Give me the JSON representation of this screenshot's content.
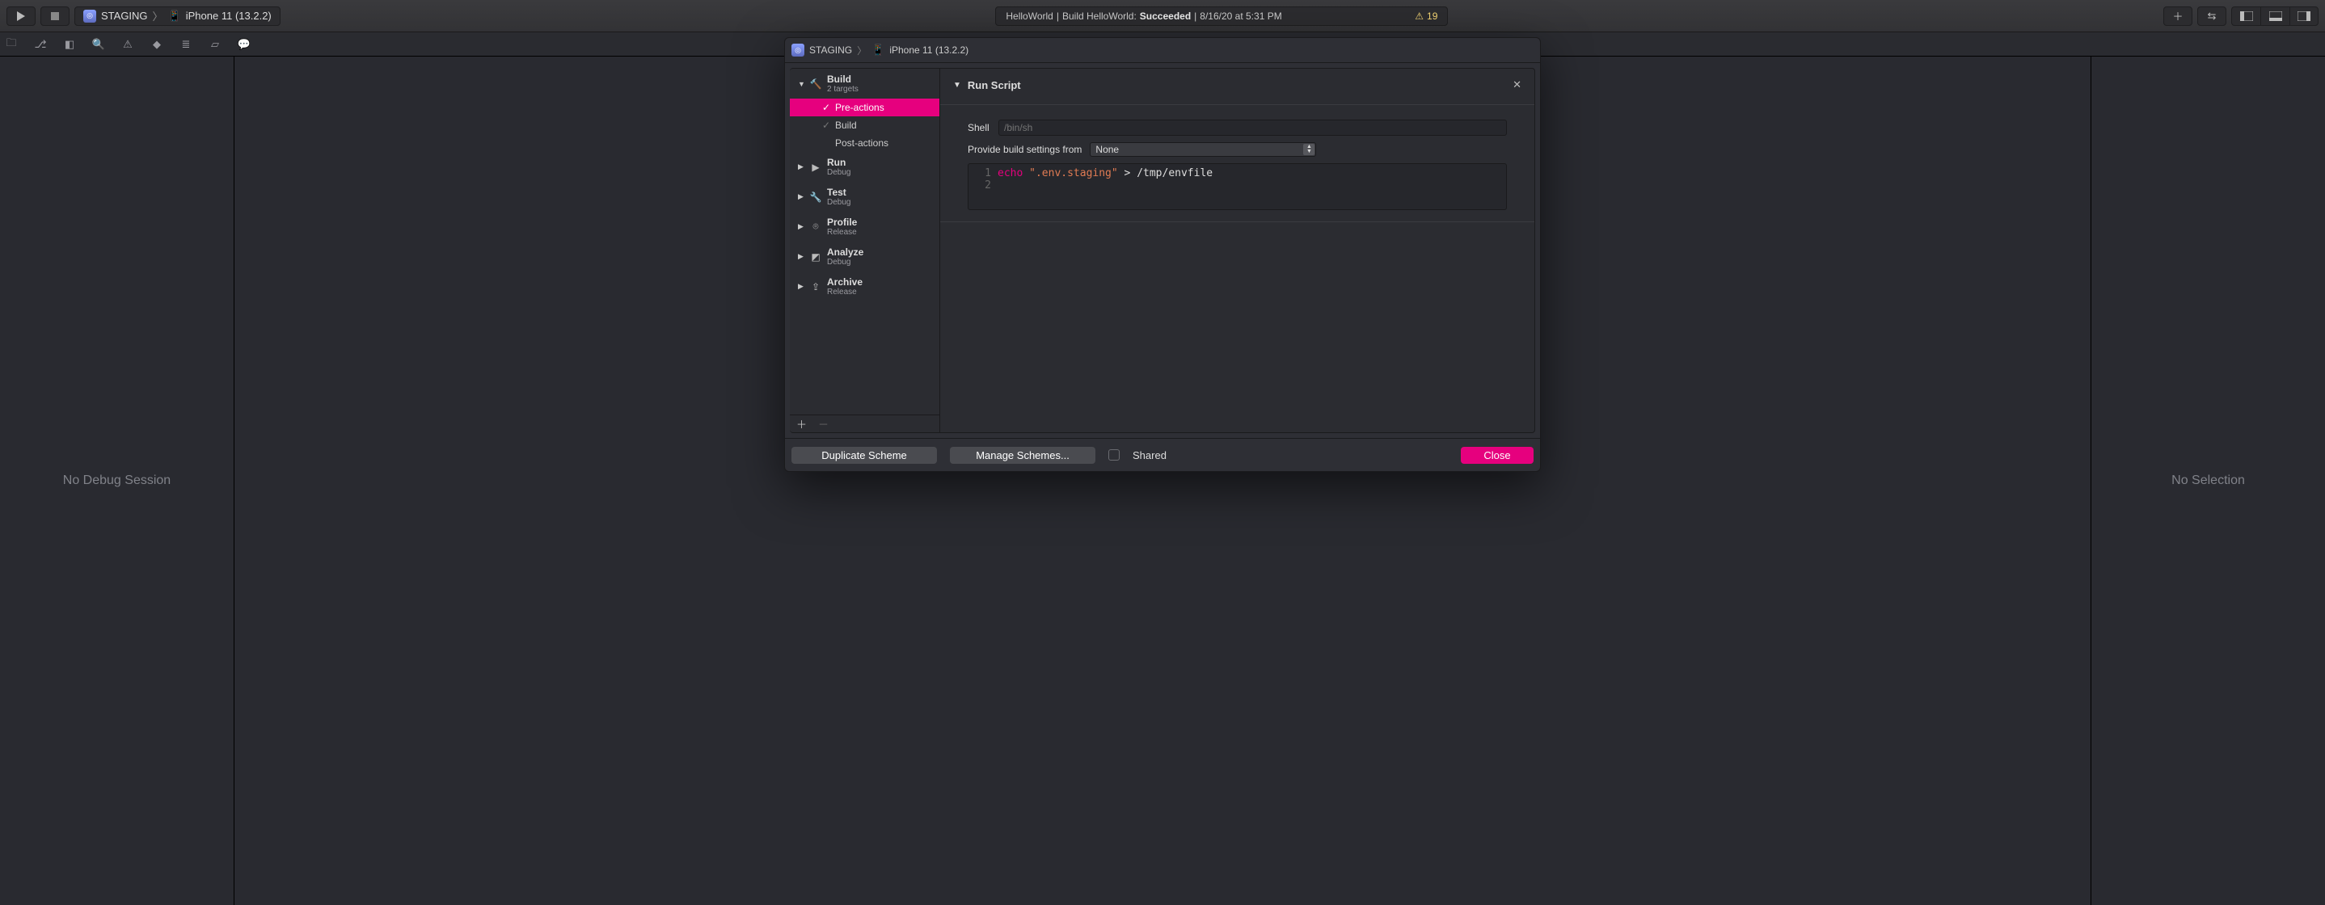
{
  "toolbar": {
    "scheme": "STAGING",
    "destination": "iPhone 11 (13.2.2)"
  },
  "activity": {
    "project": "HelloWorld",
    "action": "Build HelloWorld:",
    "status": "Succeeded",
    "timestamp": "8/16/20 at 5:31 PM",
    "warn_count": "19"
  },
  "nav_left_msg": "No Debug Session",
  "inspector_msg": "No Selection",
  "sheet": {
    "crumb_scheme": "STAGING",
    "crumb_dest": "iPhone 11 (13.2.2)",
    "sidebar": {
      "build": {
        "title": "Build",
        "sub": "2 targets"
      },
      "pre_actions": "Pre-actions",
      "build_item": "Build",
      "post_actions": "Post-actions",
      "run": {
        "title": "Run",
        "sub": "Debug"
      },
      "test": {
        "title": "Test",
        "sub": "Debug"
      },
      "profile": {
        "title": "Profile",
        "sub": "Release"
      },
      "analyze": {
        "title": "Analyze",
        "sub": "Debug"
      },
      "archive": {
        "title": "Archive",
        "sub": "Release"
      }
    },
    "content": {
      "section_title": "Run Script",
      "shell_label": "Shell",
      "shell_placeholder": "/bin/sh",
      "build_settings_label": "Provide build settings from",
      "build_settings_value": "None",
      "script_line1_cmd": "echo",
      "script_line1_str": "\".env.staging\"",
      "script_line1_rest": " > /tmp/envfile"
    },
    "footer": {
      "duplicate": "Duplicate Scheme",
      "manage": "Manage Schemes...",
      "shared": "Shared",
      "close": "Close"
    }
  }
}
